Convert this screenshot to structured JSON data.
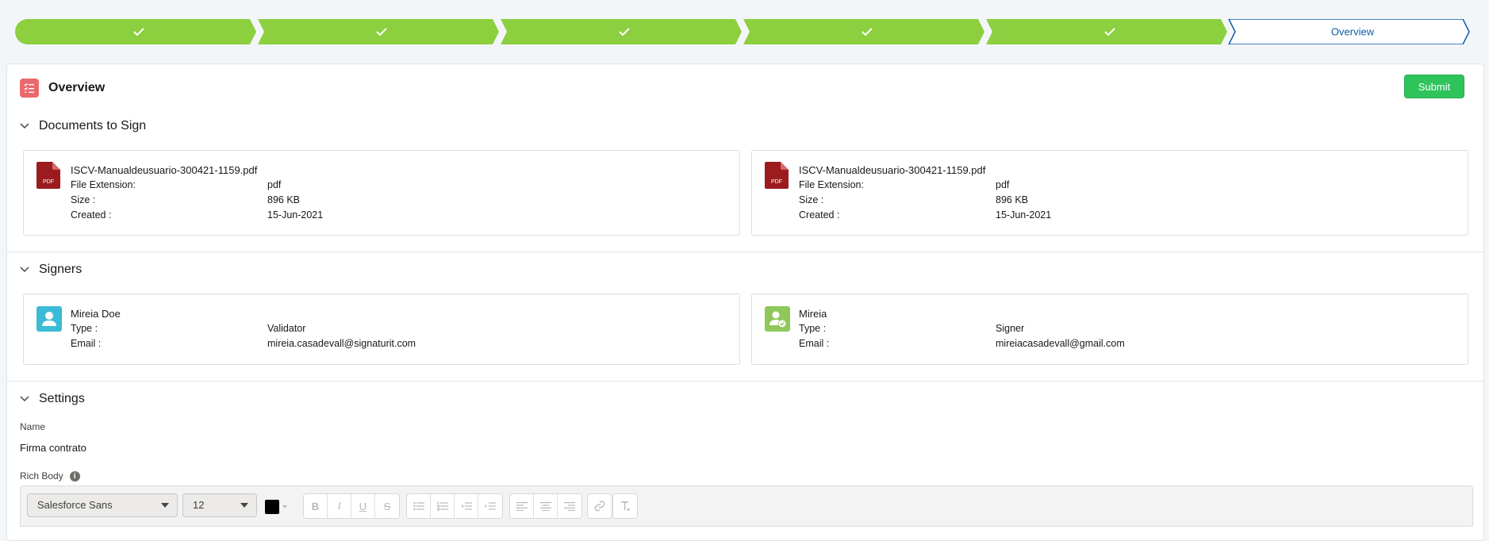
{
  "path": {
    "stages": [
      {
        "status": "complete",
        "label": ""
      },
      {
        "status": "complete",
        "label": ""
      },
      {
        "status": "complete",
        "label": ""
      },
      {
        "status": "complete",
        "label": ""
      },
      {
        "status": "complete",
        "label": ""
      },
      {
        "status": "current",
        "label": "Overview"
      }
    ],
    "complete_color": "#8ccf3f",
    "current_border_color": "#0b5cab"
  },
  "header": {
    "title": "Overview",
    "icon": "task-list-icon",
    "icon_color": "#e9696e",
    "submit_label": "Submit",
    "submit_color": "#2fc35c"
  },
  "documents": {
    "heading": "Documents to Sign",
    "items": [
      {
        "name": "ISCV-Manualdeusuario-300421-1159.pdf",
        "icon_label": "PDF",
        "fields": [
          {
            "label": "File Extension:",
            "value": "pdf"
          },
          {
            "label": "Size :",
            "value": "896 KB"
          },
          {
            "label": "Created :",
            "value": "15-Jun-2021"
          }
        ]
      },
      {
        "name": "ISCV-Manualdeusuario-300421-1159.pdf",
        "icon_label": "PDF",
        "fields": [
          {
            "label": "File Extension:",
            "value": "pdf"
          },
          {
            "label": "Size :",
            "value": "896 KB"
          },
          {
            "label": "Created :",
            "value": "15-Jun-2021"
          }
        ]
      }
    ]
  },
  "signers": {
    "heading": "Signers",
    "items": [
      {
        "name": "Mireia Doe",
        "icon": "contact-icon",
        "icon_color": "#3bbbd6",
        "fields": [
          {
            "label": "Type :",
            "value": "Validator"
          },
          {
            "label": "Email :",
            "value": "mireia.casadevall@signaturit.com"
          }
        ]
      },
      {
        "name": "Mireia",
        "icon": "user-check-icon",
        "icon_color": "#8fc85a",
        "fields": [
          {
            "label": "Type :",
            "value": "Signer"
          },
          {
            "label": "Email :",
            "value": "mireiacasadevall@gmail.com"
          }
        ]
      }
    ]
  },
  "settings": {
    "heading": "Settings",
    "name_label": "Name",
    "name_value": "Firma contrato",
    "rich_body_label": "Rich Body",
    "toolbar": {
      "font_family": "Salesforce Sans",
      "font_size": "12",
      "text_color": "#000000"
    }
  }
}
